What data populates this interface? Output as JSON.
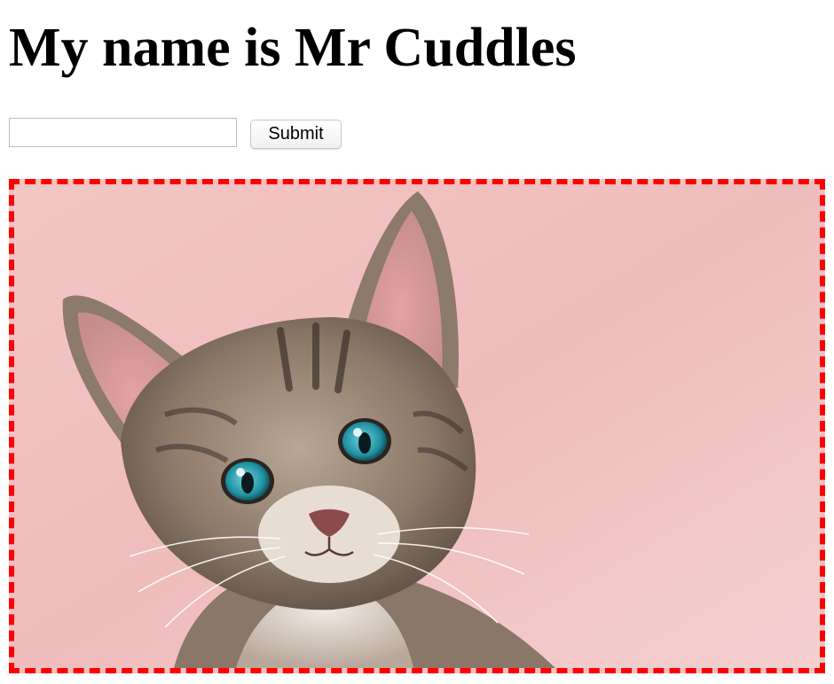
{
  "page": {
    "title": "My name is Mr Cuddles"
  },
  "form": {
    "input_value": "",
    "input_placeholder": "",
    "submit_label": "Submit"
  },
  "image": {
    "subject": "kitten-photo",
    "frame_border_color": "#ff0000",
    "background_color": "#f0c3c3"
  }
}
